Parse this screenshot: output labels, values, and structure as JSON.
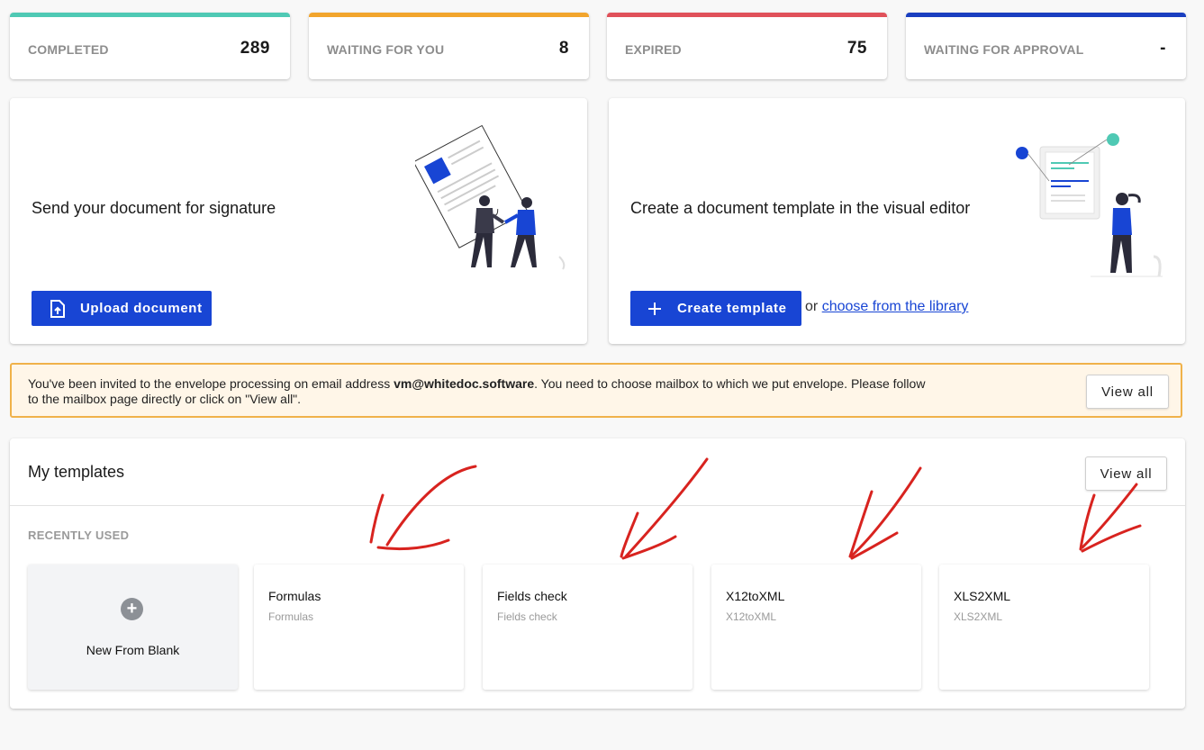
{
  "stats": [
    {
      "label": "COMPLETED",
      "value": "289",
      "color": "#4fc9b4"
    },
    {
      "label": "WAITING FOR YOU",
      "value": "8",
      "color": "#f2a52d"
    },
    {
      "label": "EXPIRED",
      "value": "75",
      "color": "#e0515a"
    },
    {
      "label": "WAITING FOR APPROVAL",
      "value": "-",
      "color": "#1a3fc0"
    }
  ],
  "send_card": {
    "title": "Send your document for signature",
    "button_label": "Upload document",
    "icon": "upload-file-icon"
  },
  "template_card": {
    "title": "Create a document template in the visual editor",
    "button_label": "Create template",
    "icon": "plus-icon",
    "or_text": "or",
    "library_link": "choose from the library"
  },
  "notice": {
    "text_before": "You've been invited to the envelope processing on email address ",
    "email": "vm@whitedoc.software",
    "text_after": ". You need to choose mailbox to which we put envelope. Please follow to the mailbox page directly or click on \"View all\".",
    "button_label": "View all"
  },
  "templates": {
    "heading": "My templates",
    "view_all_label": "View all",
    "recent_label": "RECENTLY USED",
    "new_blank_label": "New From Blank",
    "items": [
      {
        "name": "Formulas",
        "subtitle": "Formulas"
      },
      {
        "name": "Fields check",
        "subtitle": "Fields check"
      },
      {
        "name": "X12toXML",
        "subtitle": "X12toXML"
      },
      {
        "name": "XLS2XML",
        "subtitle": "XLS2XML"
      }
    ]
  },
  "colors": {
    "primary": "#1845d4",
    "notice_bg": "#fff6e8",
    "notice_border": "#f0b24a",
    "annotation_arrows": "#d8231f"
  }
}
